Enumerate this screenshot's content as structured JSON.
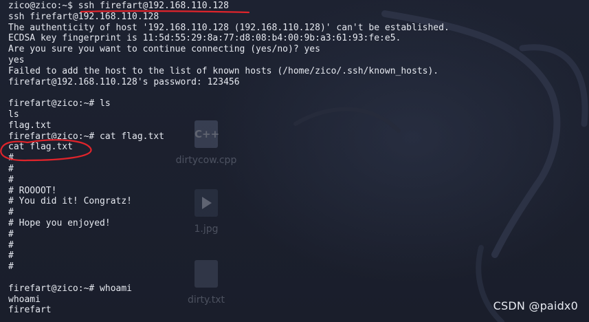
{
  "desktop": {
    "icons": [
      {
        "name": "cpp-file",
        "label": "dirtycow.cpp",
        "glyph": "C++"
      },
      {
        "name": "image-file",
        "label": "1.jpg",
        "glyph": "play-icon"
      },
      {
        "name": "text-file",
        "label": "dirty.txt",
        "glyph": "document-icon"
      }
    ]
  },
  "terminal": {
    "lines": [
      "zico@zico:~$ ssh firefart@192.168.110.128",
      "ssh firefart@192.168.110.128",
      "The authenticity of host '192.168.110.128 (192.168.110.128)' can't be established.",
      "ECDSA key fingerprint is 11:5d:55:29:8a:77:d8:08:b4:00:9b:a3:61:93:fe:e5.",
      "Are you sure you want to continue connecting (yes/no)? yes",
      "yes",
      "Failed to add the host to the list of known hosts (/home/zico/.ssh/known_hosts).",
      "firefart@192.168.110.128's password: 123456",
      "",
      "firefart@zico:~# ls",
      "ls",
      "flag.txt",
      "firefart@zico:~# cat flag.txt",
      "cat flag.txt",
      "#",
      "#",
      "#",
      "# ROOOOT!",
      "# You did it! Congratz!",
      "#",
      "# Hope you enjoyed!",
      "#",
      "#",
      "#",
      "#",
      "",
      "firefart@zico:~# whoami",
      "whoami",
      "firefart"
    ]
  },
  "watermark": "CSDN @paidx0",
  "colors": {
    "background": "#1b1f2c",
    "text": "#e6e9f0",
    "annotation": "#e0242b"
  }
}
